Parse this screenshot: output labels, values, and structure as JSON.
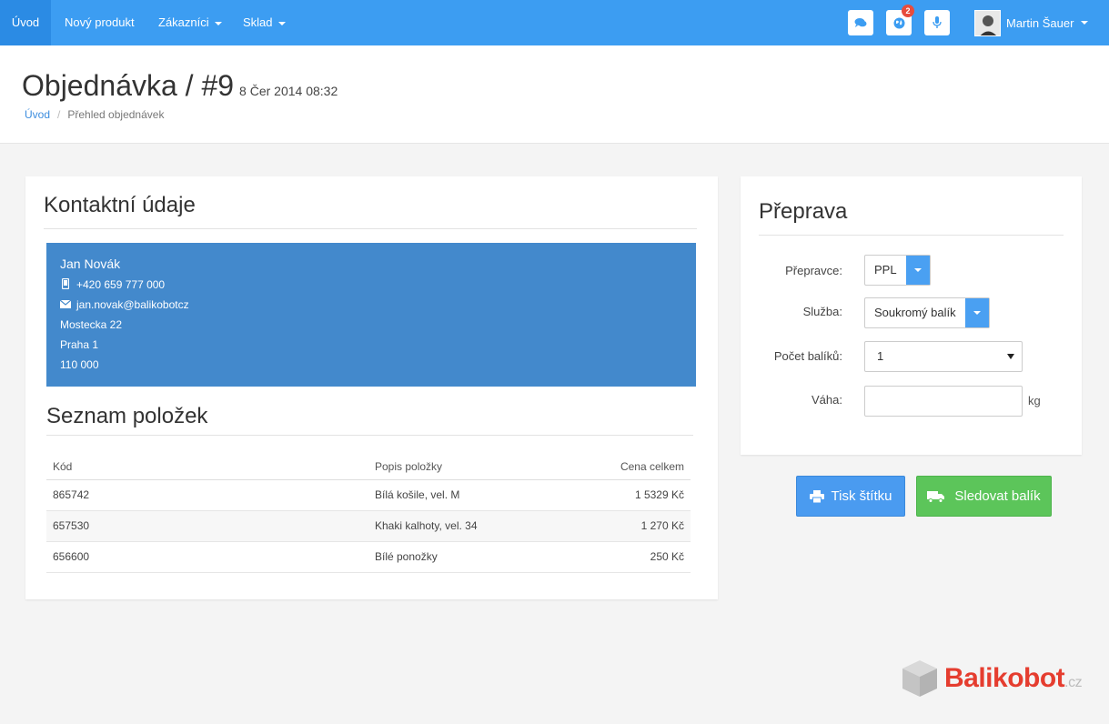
{
  "nav": {
    "items": [
      {
        "label": "Úvod",
        "active": true
      },
      {
        "label": "Nový produkt"
      },
      {
        "label": "Zákazníci",
        "dropdown": true
      },
      {
        "label": "Sklad",
        "dropdown": true
      }
    ],
    "icons": [
      "comments-icon",
      "globe-icon",
      "microphone-icon"
    ],
    "notification_count": "2",
    "user_name": "Martin Šauer"
  },
  "header": {
    "title": "Objednávka / #9",
    "date": "8 Čer 2014 08:32",
    "breadcrumb": {
      "home": "Úvod",
      "current": "Přehled objednávek"
    }
  },
  "contact": {
    "heading": "Kontaktní údaje",
    "name": "Jan Novák",
    "phone": "+420 659 777 000",
    "email": "jan.novak@balikobotcz",
    "street": "Mostecka 22",
    "city": "Praha 1",
    "zip": "110 000"
  },
  "items": {
    "heading": "Seznam položek",
    "columns": [
      "Kód",
      "Popis položky",
      "Cena celkem"
    ],
    "rows": [
      {
        "code": "865742",
        "desc": "Bílá košile, vel. M",
        "price": "1 5329 Kč"
      },
      {
        "code": "657530",
        "desc": "Khaki kalhoty, vel. 34",
        "price": "1 270 Kč"
      },
      {
        "code": "656600",
        "desc": "Bílé ponožky",
        "price": "250 Kč"
      }
    ]
  },
  "shipping": {
    "heading": "Přeprava",
    "carrier_label": "Přepravce:",
    "carrier_value": "PPL",
    "service_label": "Služba:",
    "service_value": "Soukromý balík",
    "packages_label": "Počet balíků:",
    "packages_value": "1",
    "weight_label": "Váha:",
    "weight_value": "",
    "weight_unit": "kg"
  },
  "actions": {
    "print_label": "Tisk štítku",
    "track_label": "Sledovat balík"
  },
  "logo": {
    "name": "Balikobot",
    "tld": ".cz"
  },
  "colors": {
    "nav": "#3c9df2",
    "contact_bg": "#4389cc",
    "print_btn": "#4a9bf0",
    "track_btn": "#5cc55a",
    "brand": "#e53d2f"
  }
}
